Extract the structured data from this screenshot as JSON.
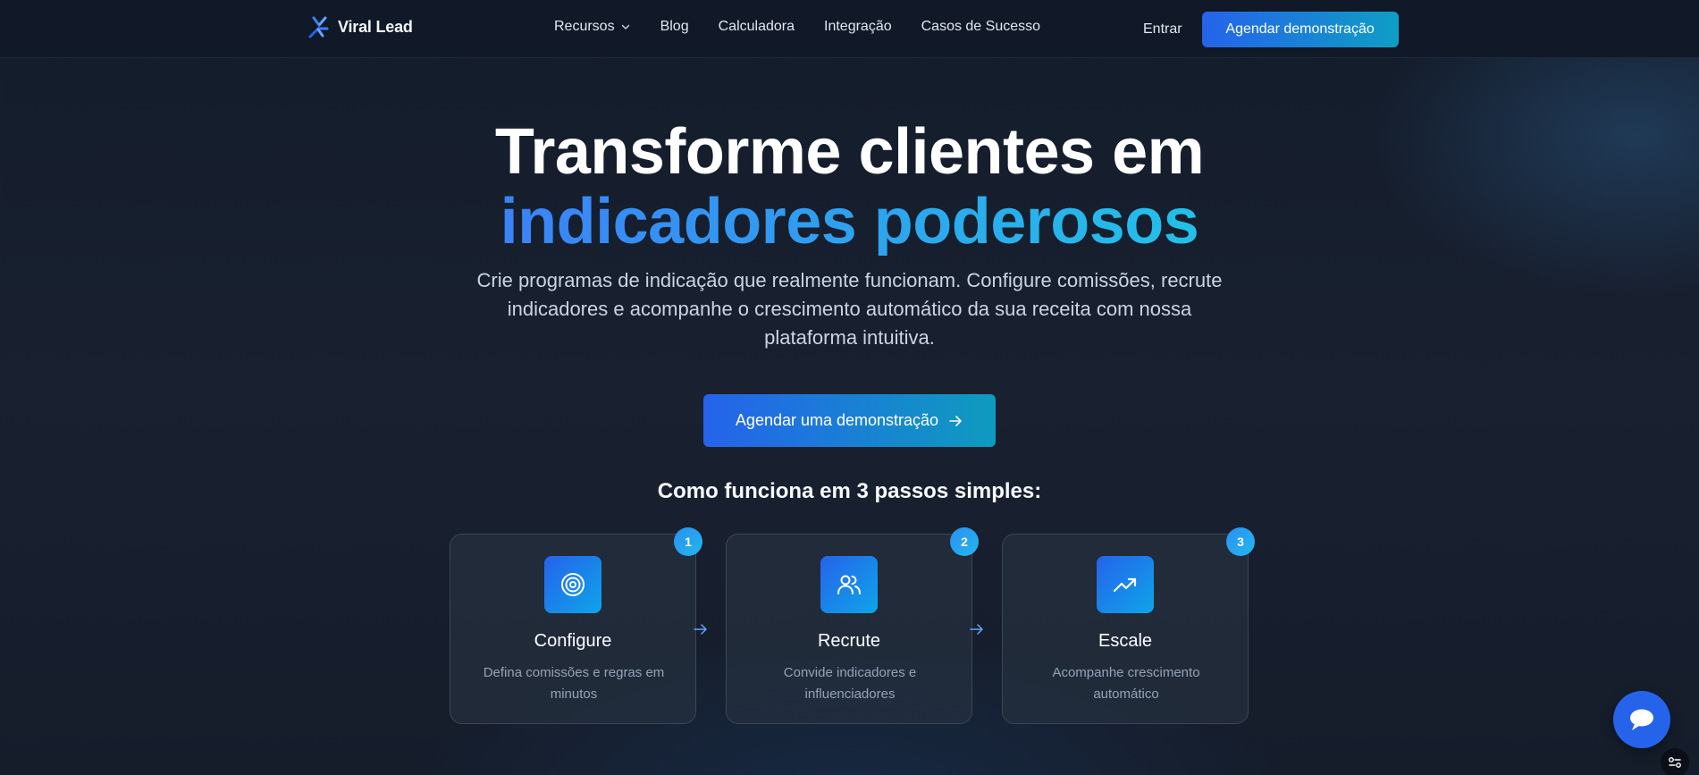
{
  "nav": {
    "logo_text": "Viral Lead",
    "links": [
      {
        "label": "Recursos",
        "has_dropdown": true,
        "icon": "chevron-down-icon"
      },
      {
        "label": "Blog"
      },
      {
        "label": "Calculadora"
      },
      {
        "label": "Integração"
      },
      {
        "label": "Casos de Sucesso"
      }
    ],
    "login_label": "Entrar",
    "demo_button_label": "Agendar demonstração"
  },
  "hero": {
    "title_line1": "Transforme clientes em",
    "title_line2": "indicadores poderosos",
    "subtitle": "Crie programas de indicação que realmente funcionam. Configure comissões, recrute indicadores e acompanhe o crescimento automático da sua receita com nossa plataforma intuitiva.",
    "cta_label": "Agendar uma demonstração",
    "cta_icon": "arrow-right-icon"
  },
  "steps": {
    "heading": "Como funciona em 3 passos simples:",
    "items": [
      {
        "number": "1",
        "title": "Configure",
        "description": "Defina comissões e regras em minutos",
        "icon": "target-icon"
      },
      {
        "number": "2",
        "title": "Recrute",
        "description": "Convide indicadores e influenciadores",
        "icon": "users-icon"
      },
      {
        "number": "3",
        "title": "Escale",
        "description": "Acompanhe crescimento automático",
        "icon": "trending-up-icon"
      }
    ]
  },
  "floating": {
    "chat_icon": "chat-bubble-icon",
    "settings_icon": "cookie-settings-icon"
  },
  "colors": {
    "background": "#161e2d",
    "accent_blue": "#2563eb",
    "accent_cyan": "#22c1e8",
    "nav_background": "#111827"
  }
}
